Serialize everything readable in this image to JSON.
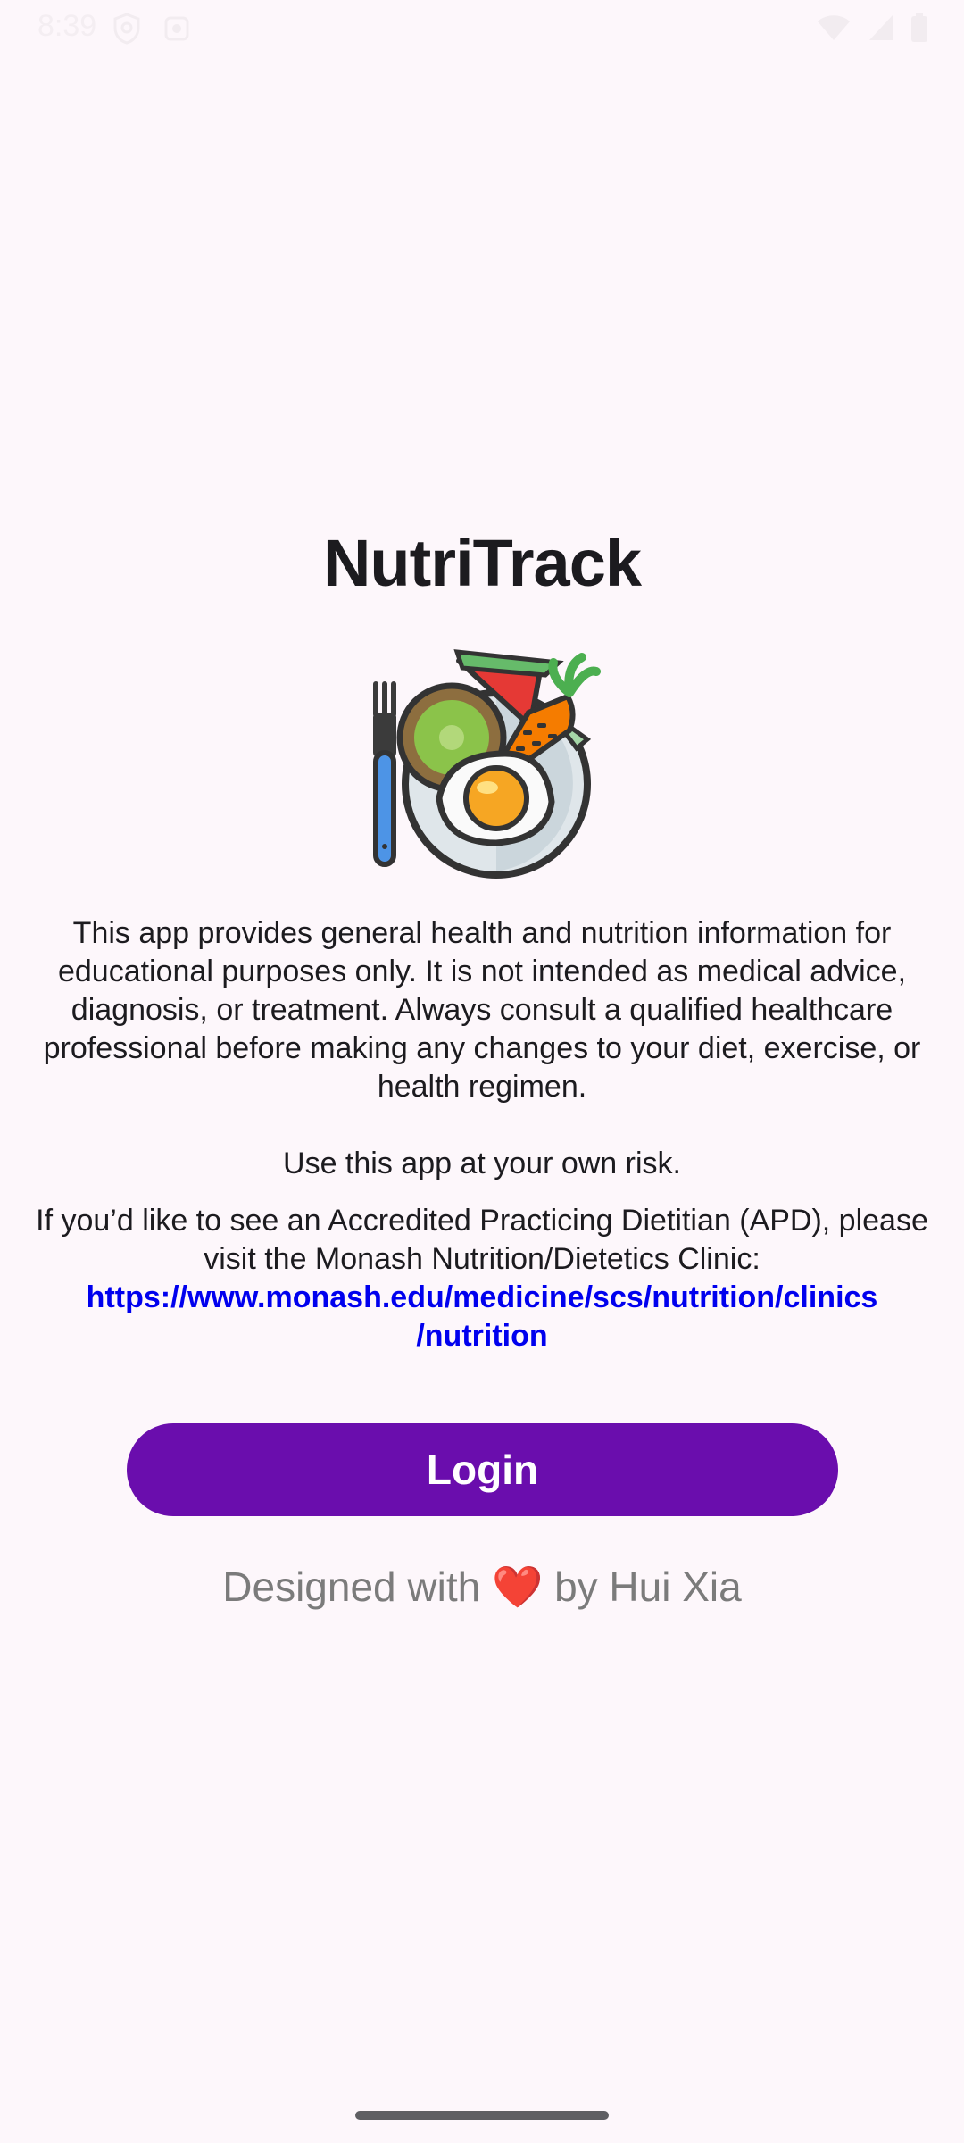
{
  "status_bar": {
    "time": "8:39",
    "left_icons": [
      "shield-icon",
      "notification-icon"
    ],
    "right_icons": [
      "wifi-icon",
      "signal-icon",
      "battery-icon"
    ]
  },
  "app": {
    "title": "NutriTrack",
    "logo_icon": "food-plate-icon"
  },
  "disclaimer": {
    "text": "This app provides general health and nutrition information for educational purposes only. It is not intended as medical advice, diagnosis, or treatment. Always consult a qualified healthcare professional before making any changes to your diet, exercise, or health regimen.",
    "risk": "Use this app at your own risk.",
    "apd_text": "If you’d like to see an Accredited Practicing Dietitian (APD), please visit the Monash Nutrition/Dietetics Clinic:",
    "apd_link_line1": "https://www.monash.edu/medicine/scs/nutrition/clinics",
    "apd_link_line2": "/nutrition"
  },
  "login": {
    "label": "Login"
  },
  "credit": {
    "prefix": "Designed with",
    "heart": "❤️",
    "suffix": "by Hui Xia"
  },
  "colors": {
    "background": "#fdf7fb",
    "primary": "#6a0dad",
    "link": "#0000ee",
    "credit": "#7b7b7b"
  }
}
